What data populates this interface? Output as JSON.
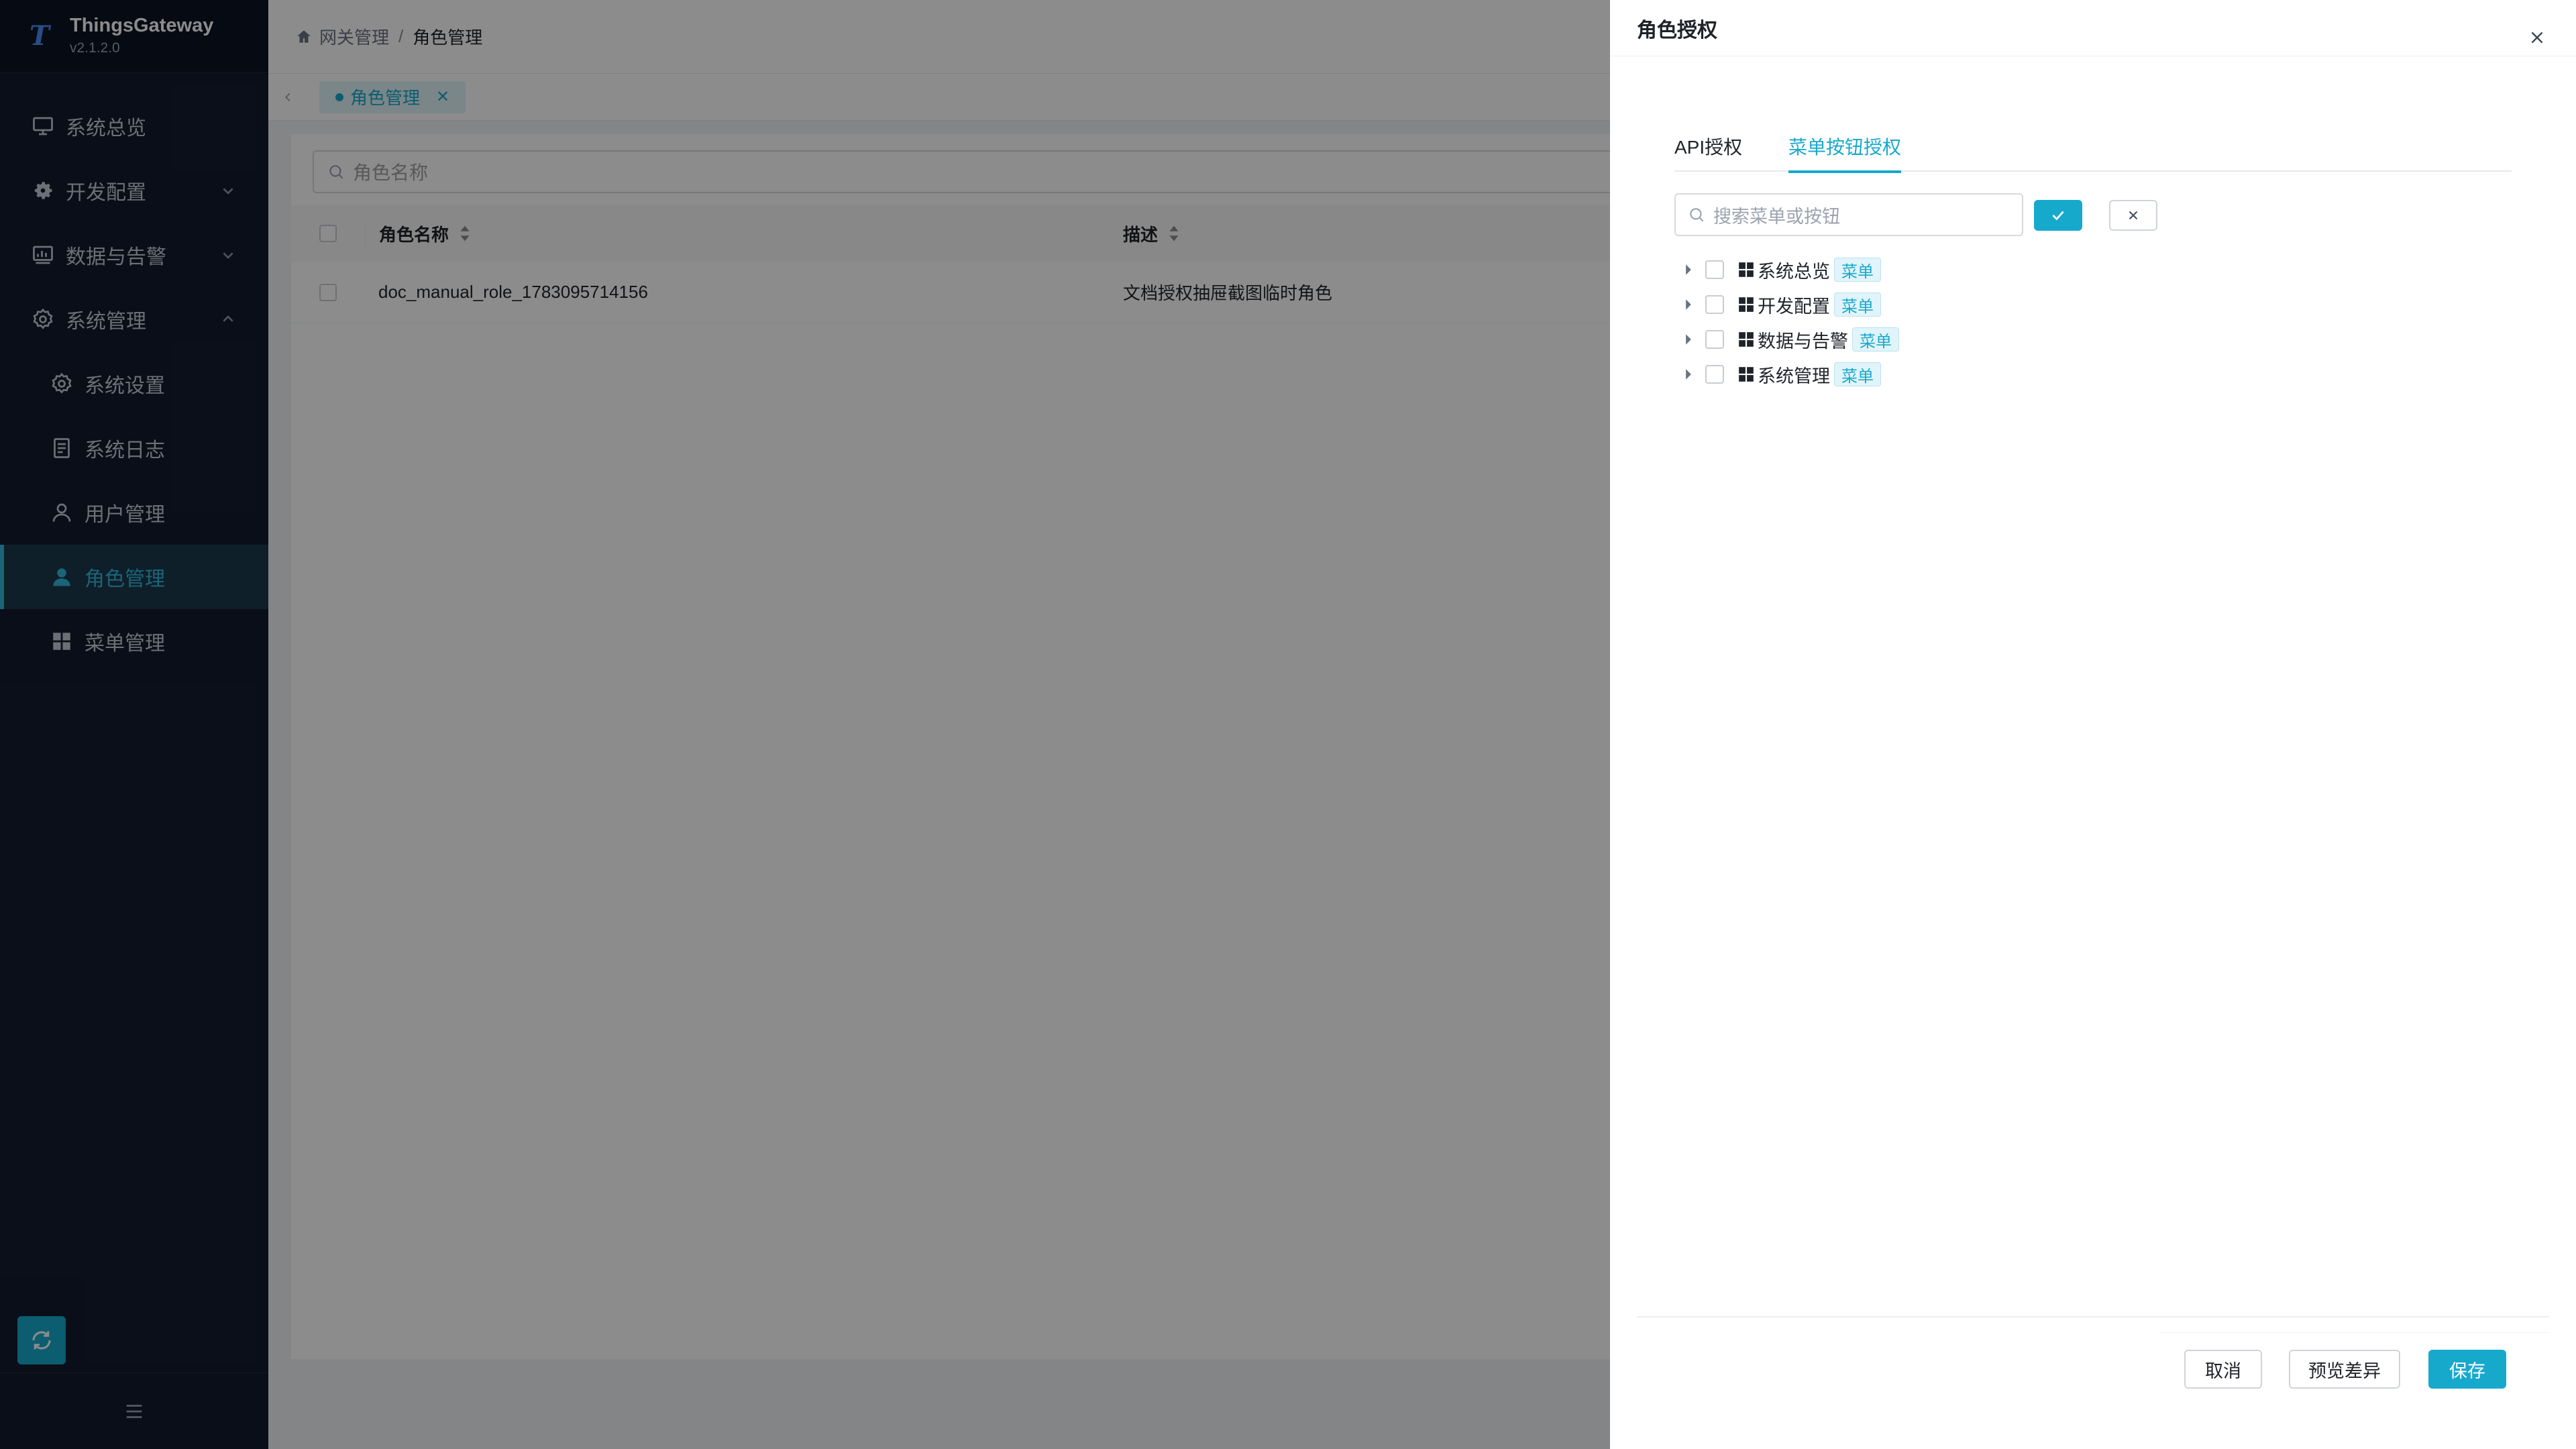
{
  "app": {
    "name": "ThingsGateway",
    "version": "v2.1.2.0",
    "logo_mark": "T"
  },
  "sidebar": {
    "items": [
      {
        "label": "系统总览",
        "icon": "monitor-icon"
      },
      {
        "label": "开发配置",
        "icon": "gear-icon"
      },
      {
        "label": "数据与告警",
        "icon": "chart-icon"
      },
      {
        "label": "系统管理",
        "icon": "settings-icon"
      },
      {
        "label": "系统设置",
        "icon": "settings-icon"
      },
      {
        "label": "系统日志",
        "icon": "document-icon"
      },
      {
        "label": "用户管理",
        "icon": "user-icon"
      },
      {
        "label": "角色管理",
        "icon": "user-filled-icon"
      },
      {
        "label": "菜单管理",
        "icon": "grid-icon"
      }
    ]
  },
  "breadcrumb": {
    "home": "网关管理",
    "separator": "/",
    "current": "角色管理"
  },
  "tabs": {
    "active_label": "角色管理"
  },
  "table": {
    "search_placeholder": "角色名称",
    "columns": [
      "角色名称",
      "描述"
    ],
    "rows": [
      {
        "name": "doc_manual_role_1783095714156",
        "description": "文档授权抽屉截图临时角色"
      }
    ]
  },
  "drawer": {
    "title": "角色授权",
    "tabs": [
      "API授权",
      "菜单按钮授权"
    ],
    "active_tab": "菜单按钮授权",
    "search_placeholder": "搜索菜单或按钮",
    "tree": [
      {
        "label": "系统总览",
        "badge": "菜单"
      },
      {
        "label": "开发配置",
        "badge": "菜单"
      },
      {
        "label": "数据与告警",
        "badge": "菜单"
      },
      {
        "label": "系统管理",
        "badge": "菜单"
      }
    ],
    "buttons": {
      "cancel": "取消",
      "preview": "预览差异",
      "save": "保存"
    }
  },
  "colors": {
    "accent": "#17a9cc",
    "sidebar_bg": "#131b2e",
    "active_bg": "#1a3a4d"
  }
}
